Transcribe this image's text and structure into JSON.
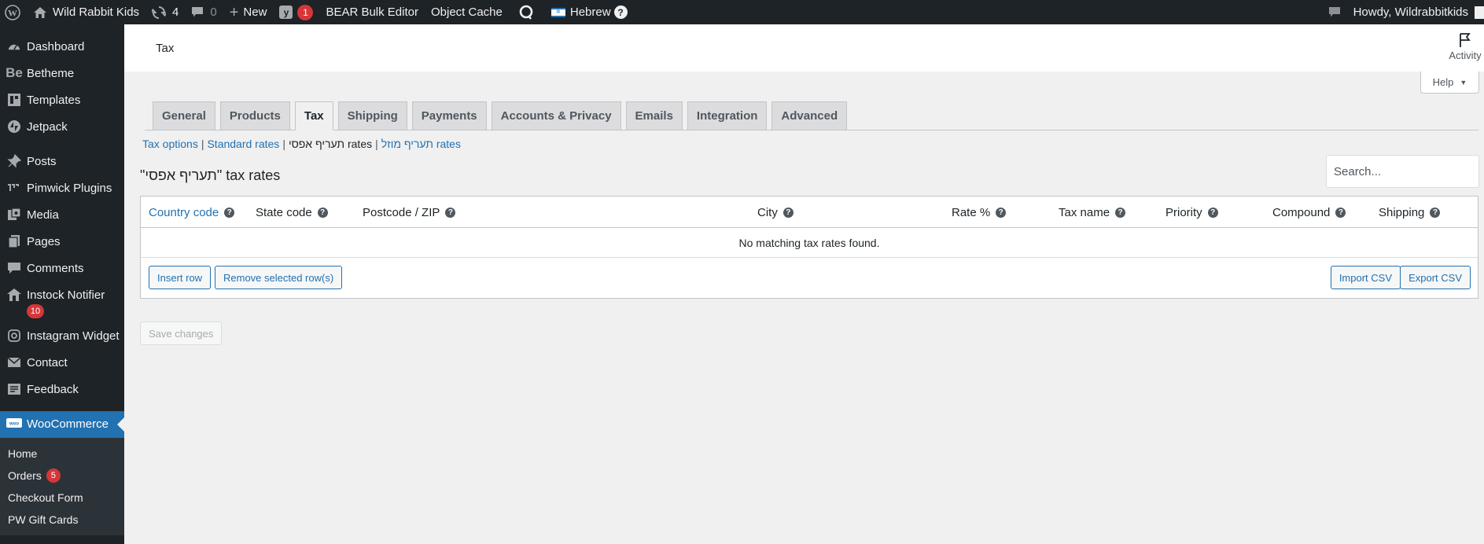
{
  "adminbar": {
    "site_name": "Wild Rabbit Kids",
    "updates_count": "4",
    "comments_count": "0",
    "new_label": "New",
    "yoast_badge": "1",
    "bulk_editor": "BEAR Bulk Editor",
    "object_cache": "Object Cache",
    "language": "Hebrew",
    "language_help": "?",
    "howdy": "Howdy, Wildrabbitkids"
  },
  "sidebar": {
    "items": [
      {
        "label": "Dashboard",
        "icon": "dashboard-icon"
      },
      {
        "label": "Betheme",
        "icon": "betheme-icon"
      },
      {
        "label": "Templates",
        "icon": "templates-icon"
      },
      {
        "label": "Jetpack",
        "icon": "jetpack-icon"
      },
      {
        "label": "Posts",
        "icon": "pin-icon"
      },
      {
        "label": "Pimwick Plugins",
        "icon": "pimwick-icon"
      },
      {
        "label": "Media",
        "icon": "media-icon"
      },
      {
        "label": "Pages",
        "icon": "pages-icon"
      },
      {
        "label": "Comments",
        "icon": "comments-icon"
      },
      {
        "label": "Instock Notifier",
        "icon": "instock-icon",
        "badge": "10"
      },
      {
        "label": "Instagram Widget",
        "icon": "instagram-icon"
      },
      {
        "label": "Contact",
        "icon": "contact-icon"
      },
      {
        "label": "Feedback",
        "icon": "feedback-icon"
      }
    ],
    "woocommerce": "WooCommerce",
    "woo_submenu": [
      {
        "label": "Home"
      },
      {
        "label": "Orders",
        "badge": "5"
      },
      {
        "label": "Checkout Form"
      },
      {
        "label": "PW Gift Cards"
      }
    ]
  },
  "header": {
    "title": "Tax",
    "activity": "Activity"
  },
  "help_label": "Help",
  "tabs": [
    {
      "label": "General"
    },
    {
      "label": "Products"
    },
    {
      "label": "Tax",
      "active": true
    },
    {
      "label": "Shipping"
    },
    {
      "label": "Payments"
    },
    {
      "label": "Accounts & Privacy"
    },
    {
      "label": "Emails"
    },
    {
      "label": "Integration"
    },
    {
      "label": "Advanced"
    }
  ],
  "subsections": {
    "tax_options": "Tax options",
    "standard_rates": "Standard rates",
    "zero_rates": "תעריף אפסי rates",
    "reduced_rates": "תעריף מוזל rates"
  },
  "rates_heading": "\"תעריף אפסי\" tax rates",
  "search": {
    "placeholder": "Search..."
  },
  "table": {
    "columns": [
      "Country code",
      "State code",
      "Postcode / ZIP",
      "City",
      "Rate %",
      "Tax name",
      "Priority",
      "Compound",
      "Shipping"
    ],
    "empty_message": "No matching tax rates found.",
    "insert_row": "Insert row",
    "remove_rows": "Remove selected row(s)",
    "import_csv": "Import CSV",
    "export_csv": "Export CSV"
  },
  "save_changes": "Save changes",
  "colors": {
    "adminbar_bg": "#1d2327",
    "accent": "#2271b1",
    "badge": "#d63638"
  }
}
